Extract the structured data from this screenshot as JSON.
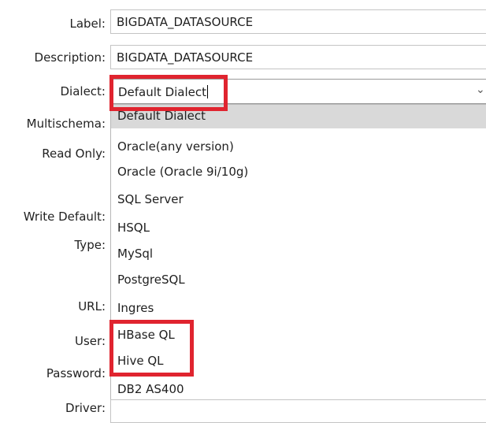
{
  "labels": {
    "label": "Label:",
    "description": "Description:",
    "dialect": "Dialect:",
    "multischema": "Multischema:",
    "read_only": "Read Only:",
    "write_default": "Write Default:",
    "type": "Type:",
    "url": "URL:",
    "user": "User:",
    "password": "Password:",
    "driver": "Driver:"
  },
  "fields": {
    "label_value": "BIGDATA_DATASOURCE",
    "description_value": "BIGDATA_DATASOURCE",
    "dialect_value": "Default Dialect"
  },
  "dialect_options": [
    "Default Dialect",
    "Oracle(any version)",
    "Oracle (Oracle 9i/10g)",
    "SQL Server",
    "HSQL",
    "MySql",
    "PostgreSQL",
    "Ingres",
    "HBase QL",
    "Hive QL",
    "DB2 AS400"
  ],
  "selected_option": "Default Dialect",
  "highlight_color": "#e0242f",
  "selected_row_color": "#d9d9d9",
  "icons": {
    "dropdown": "chevron-down-icon"
  }
}
